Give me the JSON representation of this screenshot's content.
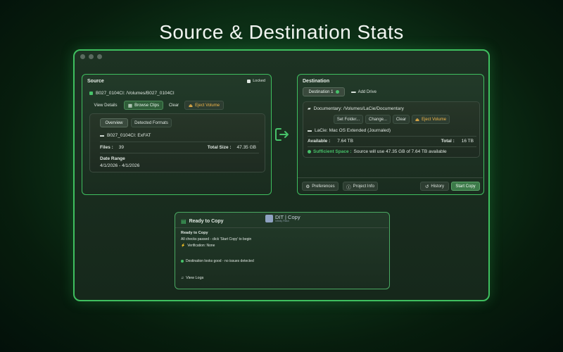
{
  "headline": "Source & Destination Stats",
  "source": {
    "title": "Source",
    "lock_label": "Locked",
    "volume_line": "B027_0104CI: /Volumes/B027_0104CI",
    "buttons": {
      "view_details": "View Details",
      "browse_clips": "Browse Clips",
      "clear": "Clear",
      "eject": "Eject Volume"
    },
    "tabs": {
      "overview": "Overview",
      "formats": "Detected Formats"
    },
    "drive_name": "B027_0104CI: ExFAT",
    "files_label": "Files :",
    "files_value": "39",
    "total_size_label": "Total Size :",
    "total_size_value": "47.35 GB",
    "date_range_label": "Date Range",
    "date_range_value": "4/1/2026 - 4/1/2026"
  },
  "destination": {
    "title": "Destination",
    "tab_dest1": "Destination 1",
    "add_drive": "Add Drive",
    "folder_line": "Documentary: /Volumes/LaCie/Documentary",
    "buttons": {
      "set_folder": "Set Folder...",
      "change": "Change...",
      "clear": "Clear",
      "eject": "Eject Volume"
    },
    "drive_line": "LaCie: Mac OS Extended (Journaled)",
    "available_label": "Available :",
    "available_value": "7.64 TB",
    "total_label": "Total :",
    "total_value": "16 TB",
    "sufficient_label": "Sufficient Space :",
    "sufficient_text": "Source will use 47.35 GB of 7.64 TB available"
  },
  "footer": {
    "preferences": "Preferences",
    "project_info": "Project Info",
    "history": "History",
    "start_copy": "Start Copy"
  },
  "ready": {
    "title": "Ready to Copy",
    "logo_text": "DIT | Copy",
    "logo_sub": "Infinity Flash",
    "status_title": "Ready to Copy",
    "status_desc": "All checks passed - click 'Start Copy' to begin",
    "verification": "Verification: None",
    "dest_ok": "Destination looks good - no issues detected",
    "view_logs": "View Logs"
  },
  "colors": {
    "accent": "#3fbf5f",
    "warn": "#f2b64a",
    "ok": "#47c26a"
  }
}
